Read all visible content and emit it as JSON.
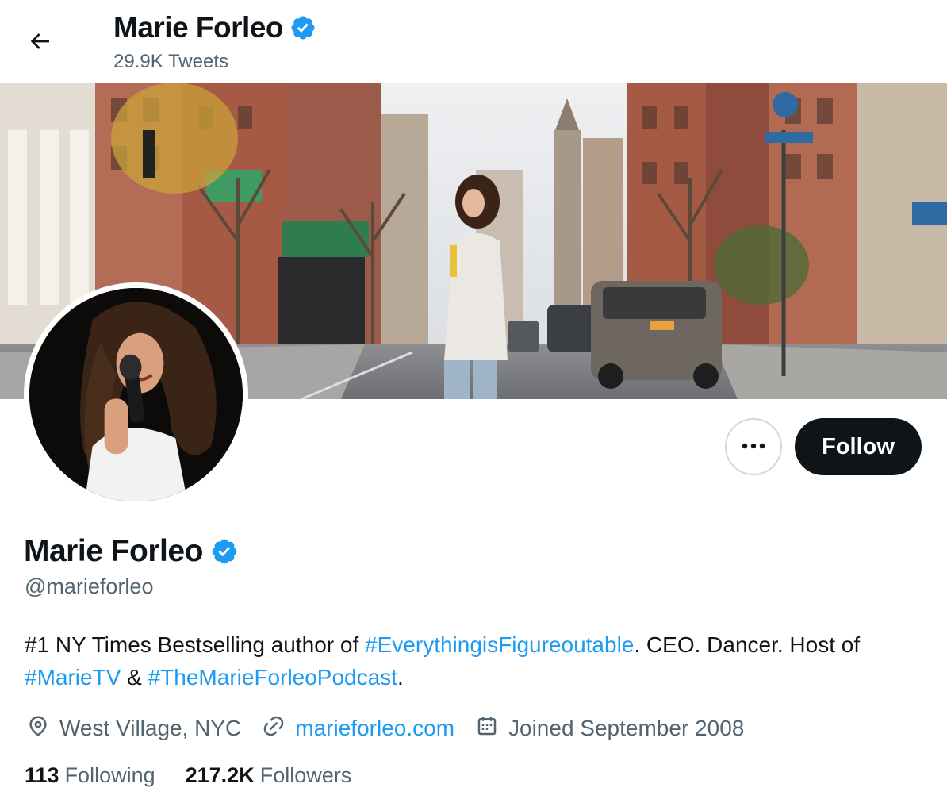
{
  "header": {
    "display_name": "Marie Forleo",
    "tweet_count": "29.9K Tweets"
  },
  "profile": {
    "display_name": "Marie Forleo",
    "handle": "@marieforleo",
    "verified": true,
    "bio": {
      "text_1": "#1 NY Times Bestselling author of ",
      "hashtag_1": "#EverythingisFigureoutable",
      "text_2": ". CEO. Dancer. Host of ",
      "hashtag_2": "#MarieTV",
      "text_3": " & ",
      "hashtag_3": "#TheMarieForleoPodcast",
      "text_4": "."
    },
    "location": "West Village, NYC",
    "website": "marieforleo.com",
    "joined": "Joined September 2008",
    "following": {
      "count": "113",
      "label": "Following"
    },
    "followers": {
      "count": "217.2K",
      "label": "Followers"
    }
  },
  "actions": {
    "follow_label": "Follow"
  },
  "icons": {
    "back": "arrow-left-icon",
    "verified": "verified-badge-icon",
    "more": "more-horizontal-icon",
    "location": "location-pin-icon",
    "link": "link-icon",
    "calendar": "calendar-icon"
  },
  "colors": {
    "accent": "#1d9bf0",
    "text_primary": "#0f1419",
    "text_secondary": "#536471",
    "button_dark": "#0f1419",
    "border": "#cfd9de"
  }
}
